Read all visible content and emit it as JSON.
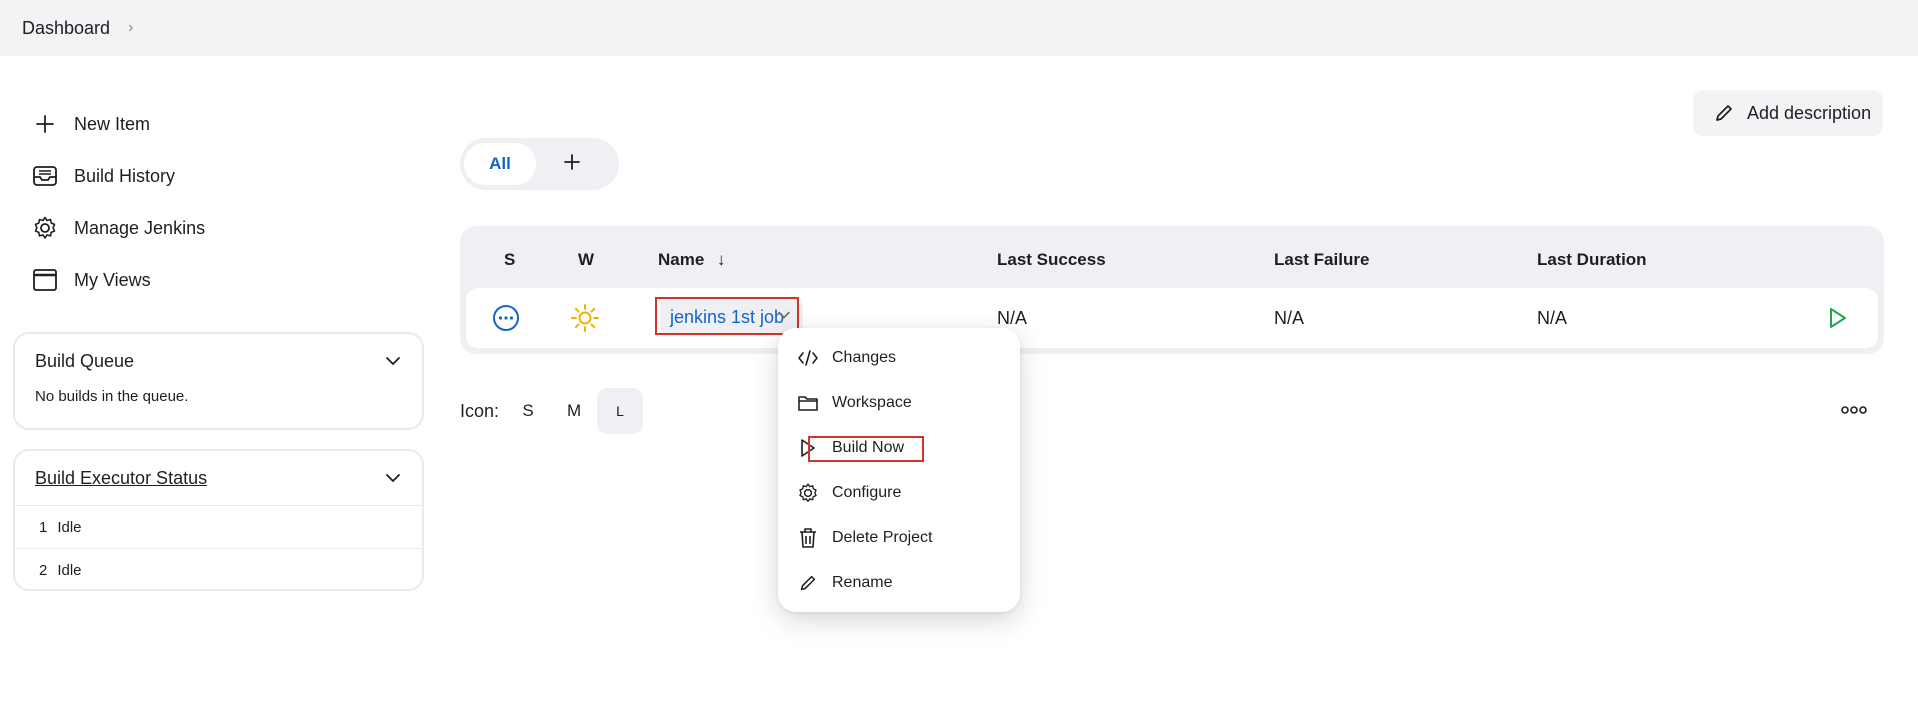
{
  "breadcrumb": {
    "home": "Dashboard",
    "separator": "›"
  },
  "tasks": [
    {
      "label": "New Item",
      "icon": "plus-icon"
    },
    {
      "label": "Build History",
      "icon": "inbox-icon"
    },
    {
      "label": "Manage Jenkins",
      "icon": "gear-icon"
    },
    {
      "label": "My Views",
      "icon": "window-icon"
    }
  ],
  "build_queue": {
    "title": "Build Queue",
    "empty_text": "No builds in the queue."
  },
  "executor_status": {
    "title": "Build Executor Status",
    "executors": [
      {
        "num": "1",
        "state": "Idle"
      },
      {
        "num": "2",
        "state": "Idle"
      }
    ]
  },
  "add_description": {
    "label": "Add description"
  },
  "view_tabs": {
    "active": "All",
    "add": "+"
  },
  "table": {
    "headers": {
      "s": "S",
      "w": "W",
      "name": "Name",
      "sort_arrow": "↓",
      "last_success": "Last Success",
      "last_failure": "Last Failure",
      "last_duration": "Last Duration"
    },
    "rows": [
      {
        "name": "jenkins 1st job",
        "last_success": "N/A",
        "last_failure": "N/A",
        "last_duration": "N/A"
      }
    ]
  },
  "icon_size": {
    "label": "Icon:",
    "options": [
      "S",
      "M",
      "L"
    ],
    "selected": "L"
  },
  "context_menu": {
    "items": [
      {
        "label": "Changes",
        "icon": "code-icon"
      },
      {
        "label": "Workspace",
        "icon": "folder-icon"
      },
      {
        "label": "Build Now",
        "icon": "play-icon"
      },
      {
        "label": "Configure",
        "icon": "gear-icon"
      },
      {
        "label": "Delete Project",
        "icon": "trash-icon"
      },
      {
        "label": "Rename",
        "icon": "pencil-icon"
      }
    ]
  },
  "colors": {
    "accent": "#1166c8",
    "weather_sun": "#f0b400",
    "build_play": "#1fa84a",
    "highlight_box": "#d0342c"
  }
}
